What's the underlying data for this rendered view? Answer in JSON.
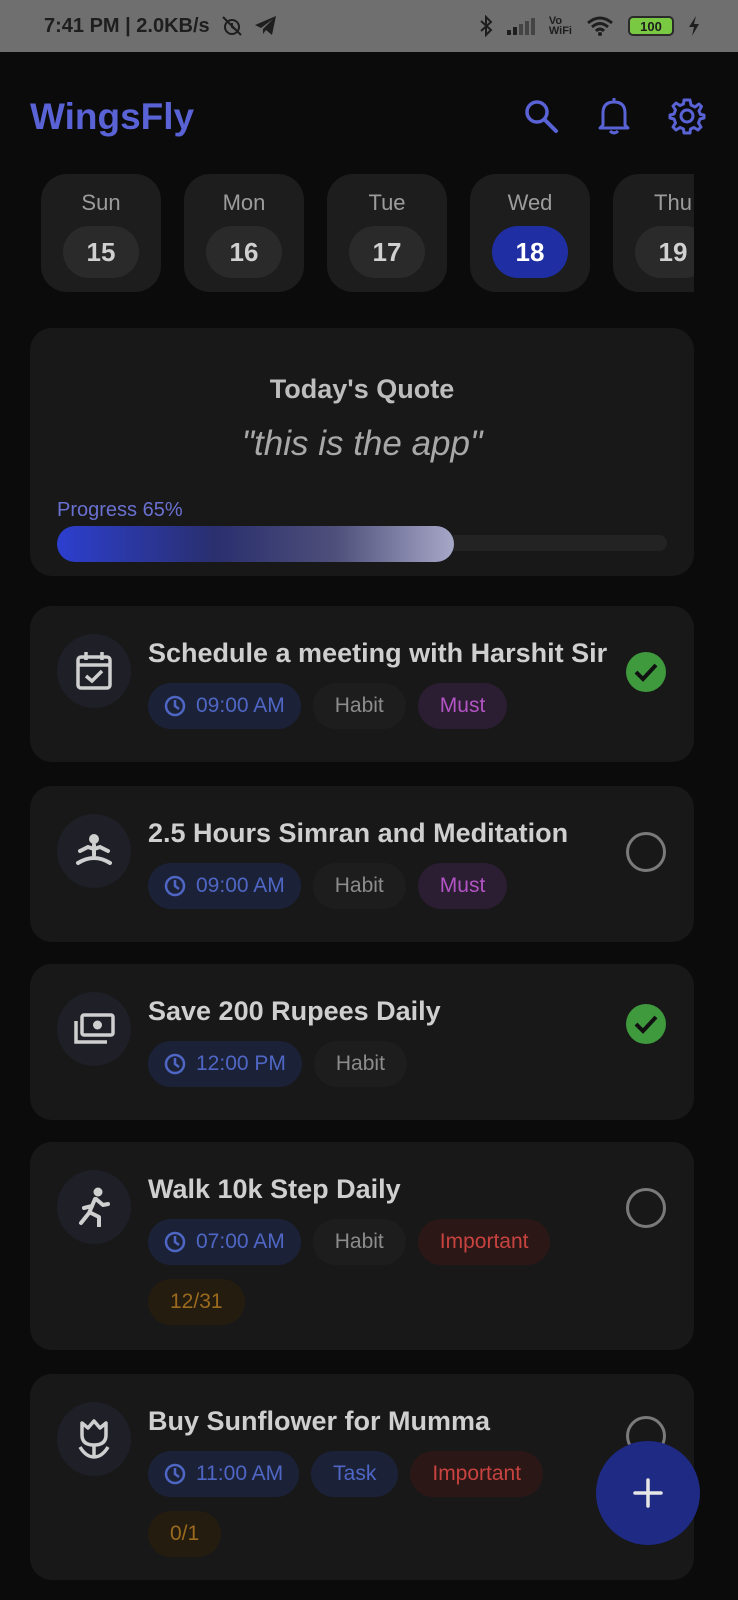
{
  "status_bar": {
    "time_speed": "7:41 PM | 2.0KB/s",
    "vo_line1": "Vo",
    "vo_line2": "WiFi",
    "battery": "100"
  },
  "header": {
    "title": "WingsFly",
    "icons": [
      "search-icon",
      "bell-icon",
      "gear-icon"
    ]
  },
  "days": [
    {
      "name": "Sun",
      "num": "15",
      "selected": false
    },
    {
      "name": "Mon",
      "num": "16",
      "selected": false
    },
    {
      "name": "Tue",
      "num": "17",
      "selected": false
    },
    {
      "name": "Wed",
      "num": "18",
      "selected": true
    },
    {
      "name": "Thu",
      "num": "19",
      "selected": false
    }
  ],
  "quote": {
    "title": "Today's Quote",
    "text": "\"this is the app\"",
    "progress_label": "Progress 65%",
    "progress": 0.65
  },
  "tasks": [
    {
      "title": "Schedule a meeting with Harshit Sir",
      "icon": "calendar-check-icon",
      "time": "09:00 AM",
      "type": "Habit",
      "priority": "Must",
      "done": true
    },
    {
      "title": "2.5 Hours Simran and Meditation",
      "icon": "meditation-icon",
      "time": "09:00 AM",
      "type": "Habit",
      "priority": "Must",
      "done": false
    },
    {
      "title": "Save 200 Rupees Daily",
      "icon": "money-icon",
      "time": "12:00 PM",
      "type": "Habit",
      "done": true
    },
    {
      "title": "Walk 10k Step Daily",
      "icon": "walking-icon",
      "time": "07:00 AM",
      "type": "Habit",
      "priority": "Important",
      "count": "12/31",
      "done": false
    },
    {
      "title": "Buy Sunflower for Mumma",
      "icon": "flower-icon",
      "time": "11:00 AM",
      "type": "Task",
      "priority": "Important",
      "count": "0/1",
      "done": false
    }
  ],
  "colors": {
    "accent": "#5a63d6",
    "selected_day": "#1f2fa3",
    "done_green": "#3f9a3e",
    "fab": "#1f2a85"
  }
}
